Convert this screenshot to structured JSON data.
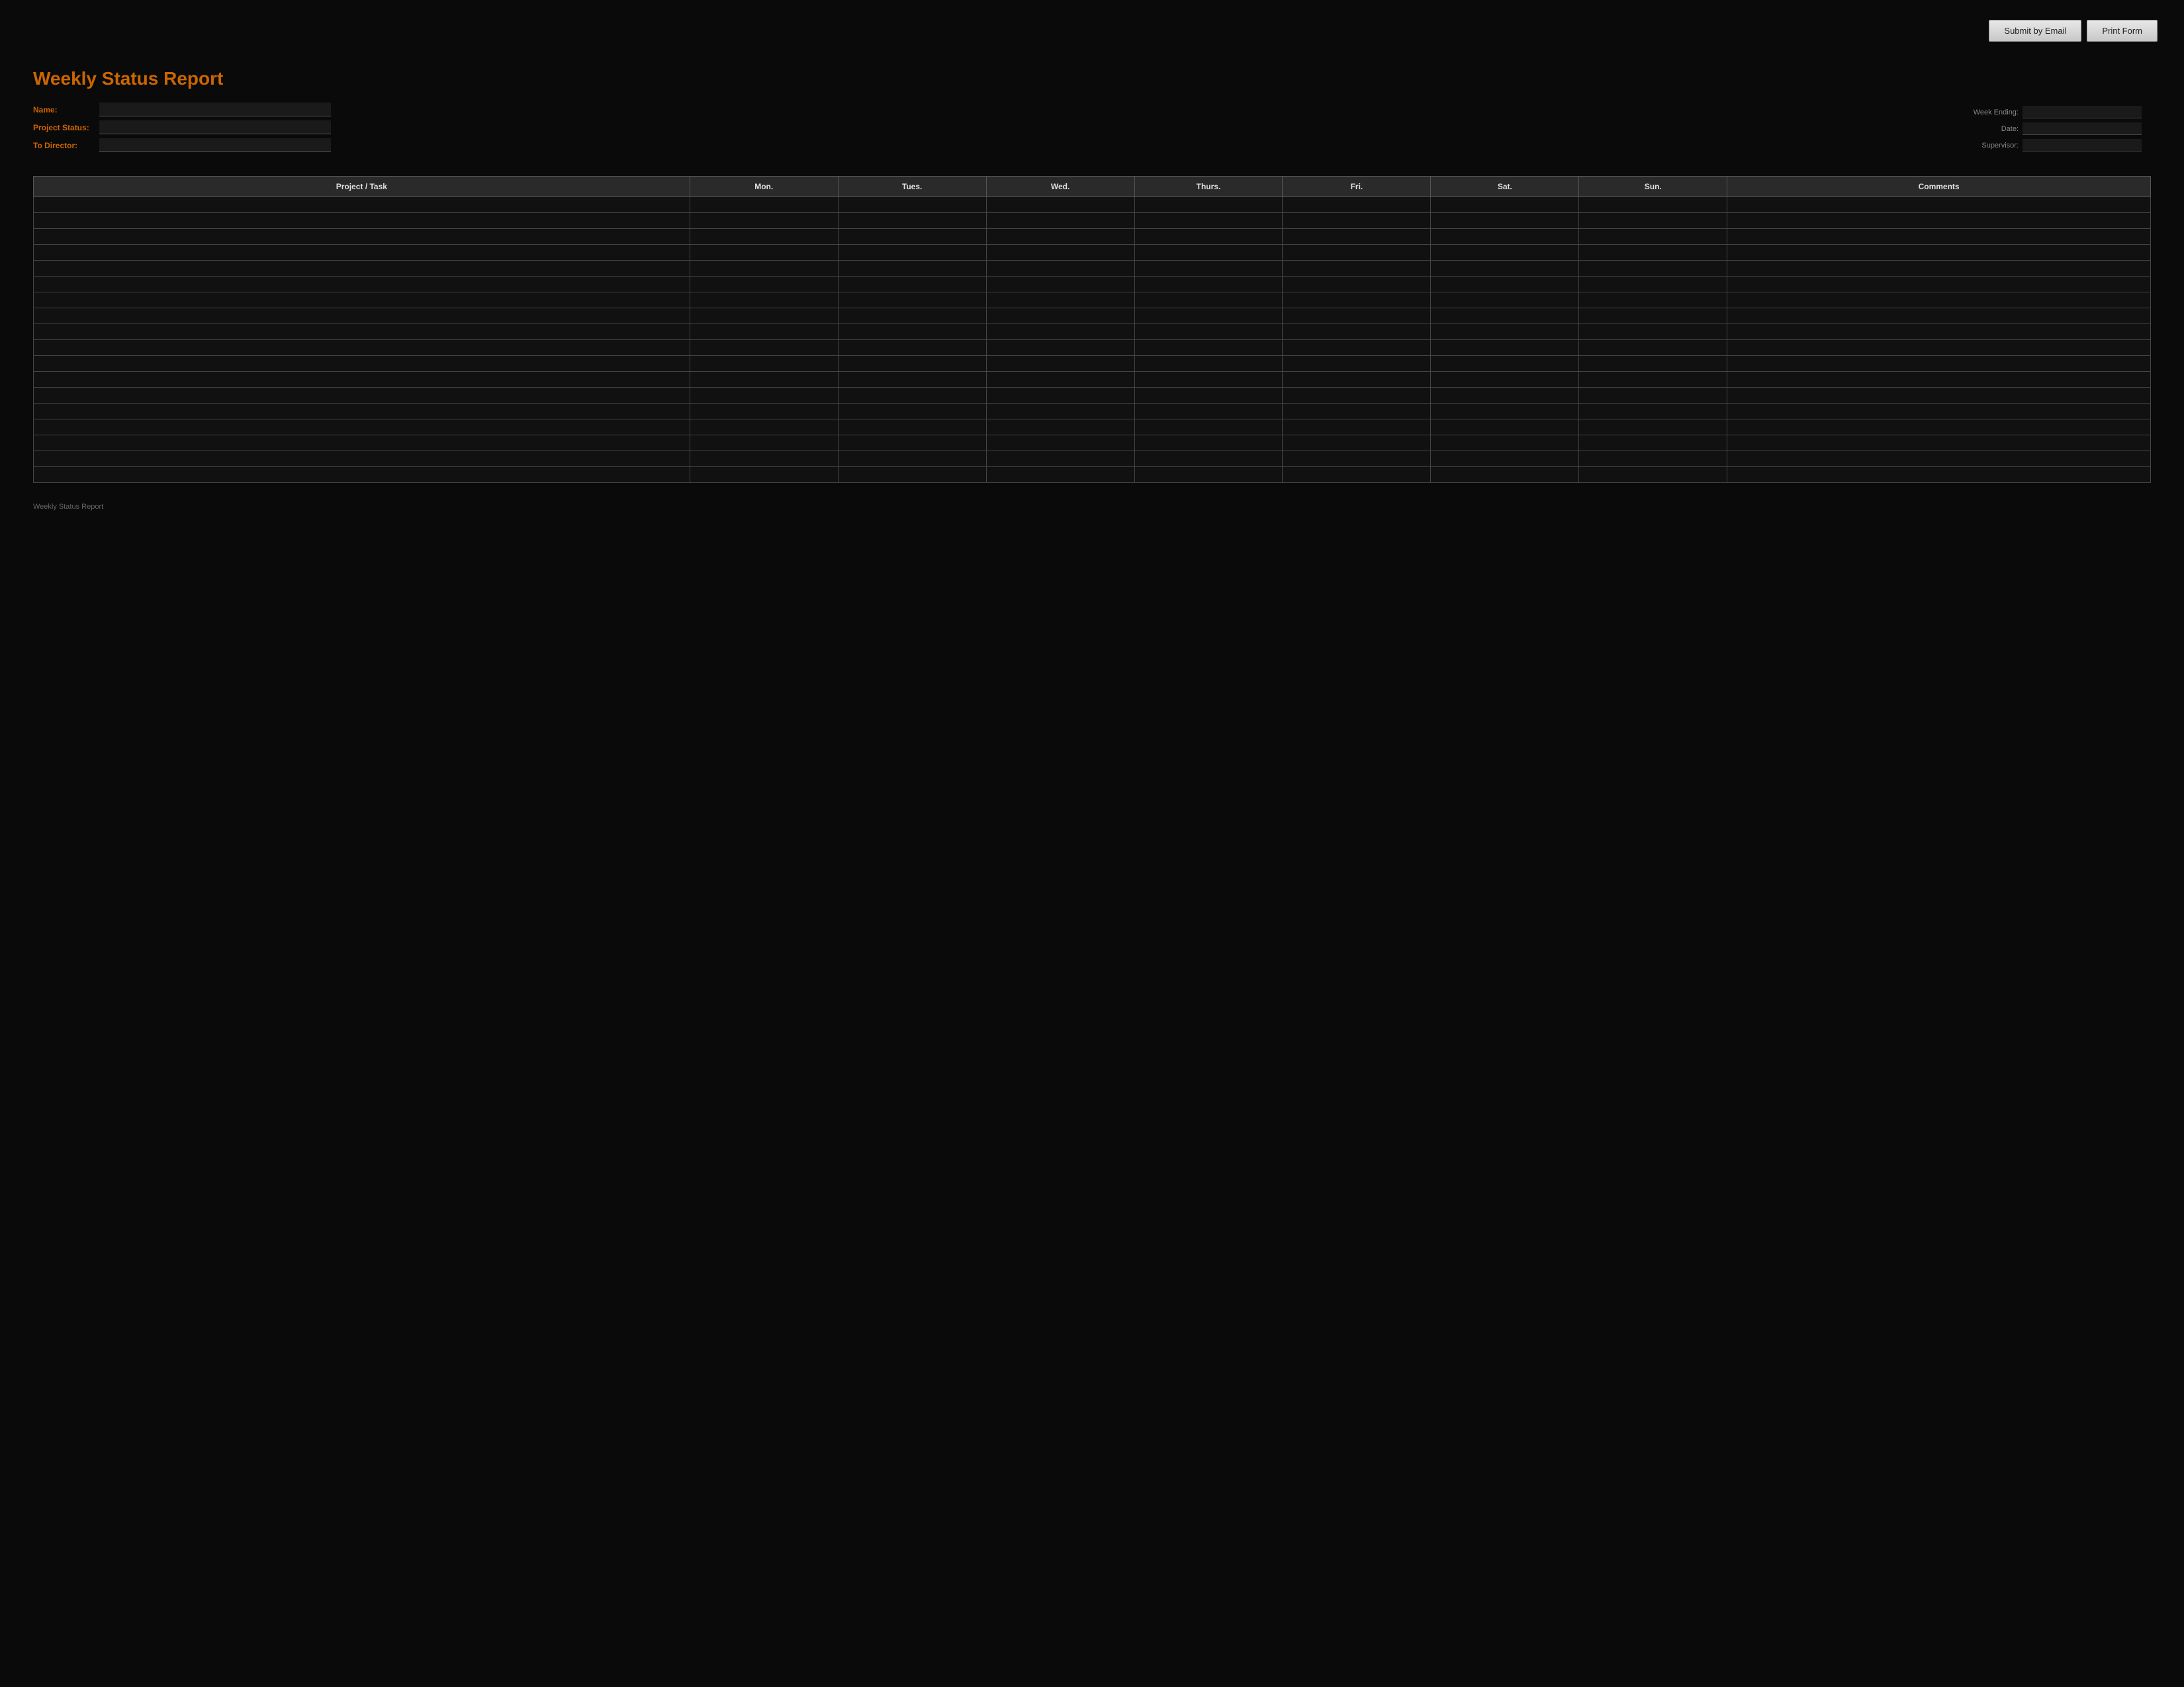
{
  "toolbar": {
    "submit_email_label": "Submit by Email",
    "print_form_label": "Print Form"
  },
  "form": {
    "title": "Weekly Status Report",
    "fields": {
      "name_label": "Name:",
      "project_status_label": "Project Status:",
      "to_director_label": "To Director:"
    },
    "right_fields": {
      "week_ending_label": "Week Ending:",
      "date_label": "Date:",
      "supervisor_label": "Supervisor:"
    }
  },
  "table": {
    "headers": [
      "Project / Task",
      "Mon.",
      "Tues.",
      "Wed.",
      "Thurs.",
      "Fri.",
      "Sat.",
      "Sun.",
      "Comments"
    ],
    "num_rows": 18
  },
  "footer": {
    "text": "Weekly Status Report"
  }
}
